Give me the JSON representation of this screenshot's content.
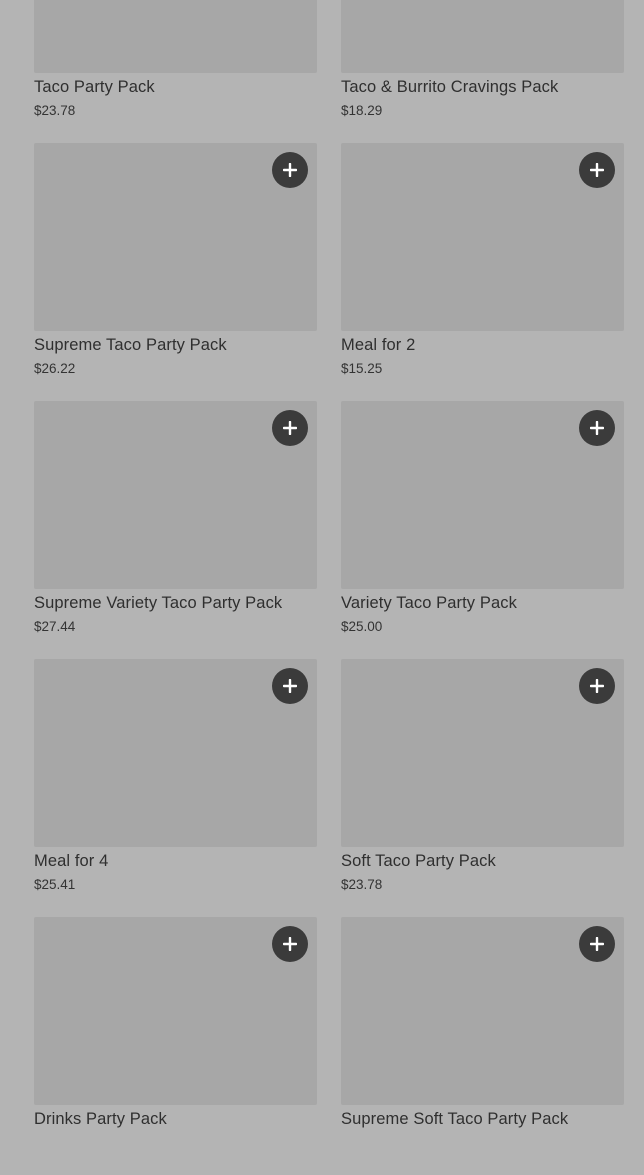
{
  "products": [
    {
      "name": "Taco Party Pack",
      "price": "$23.78",
      "add_icon": "plus-icon"
    },
    {
      "name": "Taco & Burrito Cravings Pack",
      "price": "$18.29",
      "add_icon": "plus-icon"
    },
    {
      "name": "Supreme Taco Party Pack",
      "price": "$26.22",
      "add_icon": "plus-icon"
    },
    {
      "name": "Meal for 2",
      "price": "$15.25",
      "add_icon": "plus-icon"
    },
    {
      "name": "Supreme Variety Taco Party Pack",
      "price": "$27.44",
      "add_icon": "plus-icon"
    },
    {
      "name": "Variety Taco Party Pack",
      "price": "$25.00",
      "add_icon": "plus-icon"
    },
    {
      "name": "Meal for 4",
      "price": "$25.41",
      "add_icon": "plus-icon"
    },
    {
      "name": "Soft Taco Party Pack",
      "price": "$23.78",
      "add_icon": "plus-icon"
    },
    {
      "name": "Drinks Party Pack",
      "price": "",
      "add_icon": "plus-icon"
    },
    {
      "name": "Supreme Soft Taco Party Pack",
      "price": "",
      "add_icon": "plus-icon"
    }
  ],
  "colors": {
    "background": "#b4b4b4",
    "image_placeholder": "#a7a7a7",
    "add_button": "#3b3b3b",
    "add_icon": "#ffffff",
    "text": "#2f2f2f"
  }
}
